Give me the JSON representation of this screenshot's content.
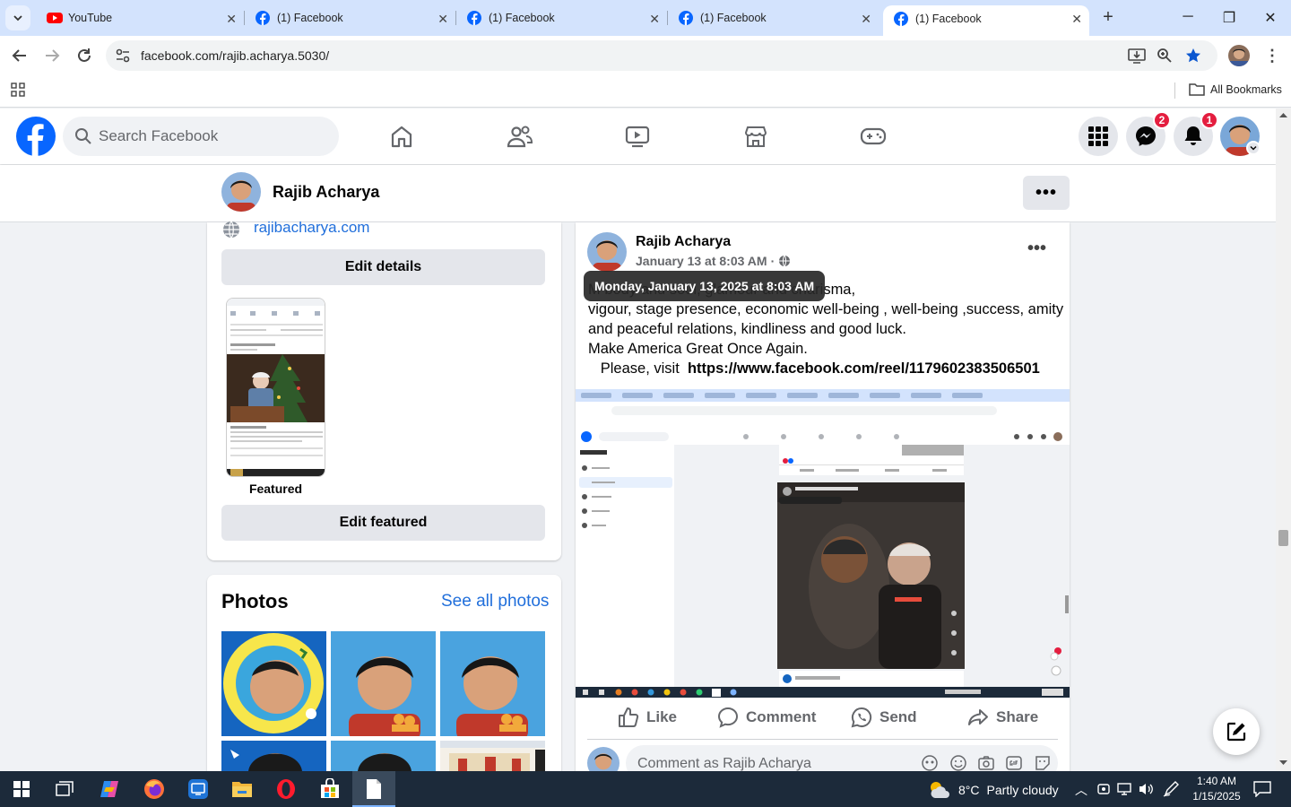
{
  "browser": {
    "tabs": [
      {
        "title": "YouTube",
        "icon": "youtube-icon"
      },
      {
        "title": "(1) Facebook",
        "icon": "facebook-icon"
      },
      {
        "title": "(1) Facebook",
        "icon": "facebook-icon"
      },
      {
        "title": "(1) Facebook",
        "icon": "facebook-icon"
      },
      {
        "title": "(1) Facebook",
        "icon": "facebook-icon",
        "active": true
      }
    ],
    "url": "facebook.com/rajib.acharya.5030/",
    "bookmarks_label": "All Bookmarks"
  },
  "fb_header": {
    "search_placeholder": "Search Facebook",
    "messenger_badge": "2",
    "notifications_badge": "1",
    "brand_color": "#0866ff"
  },
  "profile": {
    "name": "Rajib Acharya",
    "website": "rajibacharya.com",
    "edit_details_label": "Edit details",
    "featured_label": "Featured",
    "edit_featured_label": "Edit featured"
  },
  "photos": {
    "title": "Photos",
    "see_all_label": "See all photos"
  },
  "post": {
    "author": "Rajib Acharya",
    "time": "January 13 at 8:03 AM",
    "time_separator": "·",
    "tooltip": "Monday, January 13, 2025 at 8:03 AM",
    "text_lines": [
      "M                                              body and soul,  glamour and charisma,",
      "vigour, stage presence, economic well-being , well-being ,success, amity",
      "and peaceful relations, kindliness and good luck.",
      "Make America Great Once Again."
    ],
    "visit_prefix": "   Please, visit  ",
    "visit_link": "https://www.facebook.com/reel/1179602383506501",
    "actions": {
      "like": "Like",
      "comment": "Comment",
      "send": "Send",
      "share": "Share"
    },
    "comment_placeholder": "Comment as Rajib Acharya"
  },
  "taskbar": {
    "weather_temp": "8°C",
    "weather_text": "Partly cloudy",
    "time": "1:40 AM",
    "date": "1/15/2025"
  }
}
